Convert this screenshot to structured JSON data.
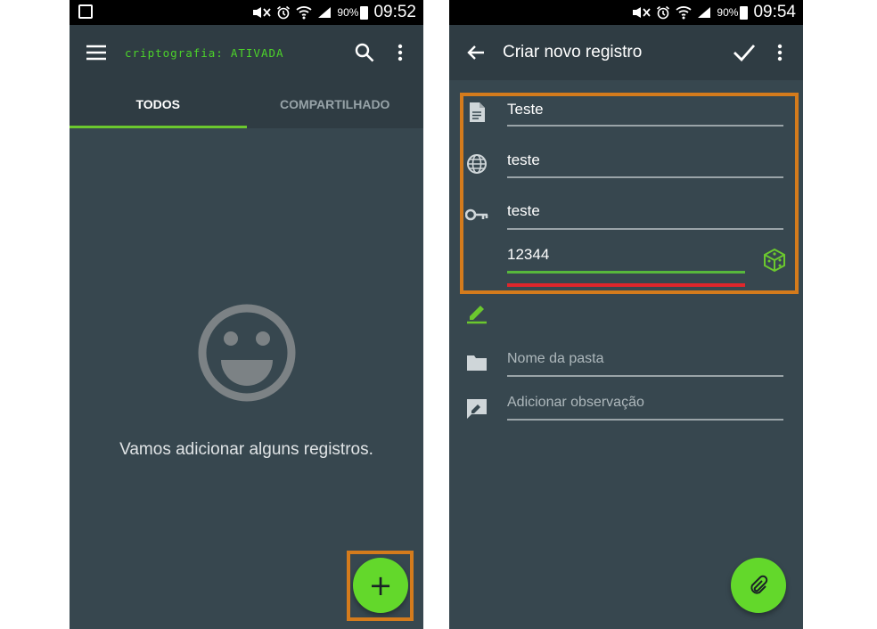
{
  "left_screen": {
    "status_bar": {
      "battery_pct": "90%",
      "time": "09:52"
    },
    "appbar": {
      "crypto_label": "criptografia:",
      "crypto_state": "ATIVADA"
    },
    "tabs": [
      {
        "label": "TODOS",
        "active": true
      },
      {
        "label": "COMPARTILHADO",
        "active": false
      }
    ],
    "empty_message": "Vamos adicionar alguns registros.",
    "fab_symbol": "+"
  },
  "right_screen": {
    "status_bar": {
      "battery_pct": "90%",
      "time": "09:54"
    },
    "appbar": {
      "title": "Criar novo registro"
    },
    "fields": {
      "name": {
        "value": "Teste",
        "icon": "document-icon"
      },
      "url": {
        "value": "teste",
        "icon": "globe-icon"
      },
      "login": {
        "value": "teste",
        "icon": "key-icon"
      },
      "password": {
        "value": "12344",
        "icon": "dice-icon"
      },
      "folder": {
        "placeholder": "Nome da pasta",
        "icon": "folder-icon"
      },
      "note": {
        "placeholder": "Adicionar observação",
        "icon": "note-icon"
      }
    }
  },
  "colors": {
    "accent": "#63d82b",
    "highlight": "#d47b1c",
    "background": "#37474f",
    "strength_bad": "#e0262b"
  }
}
